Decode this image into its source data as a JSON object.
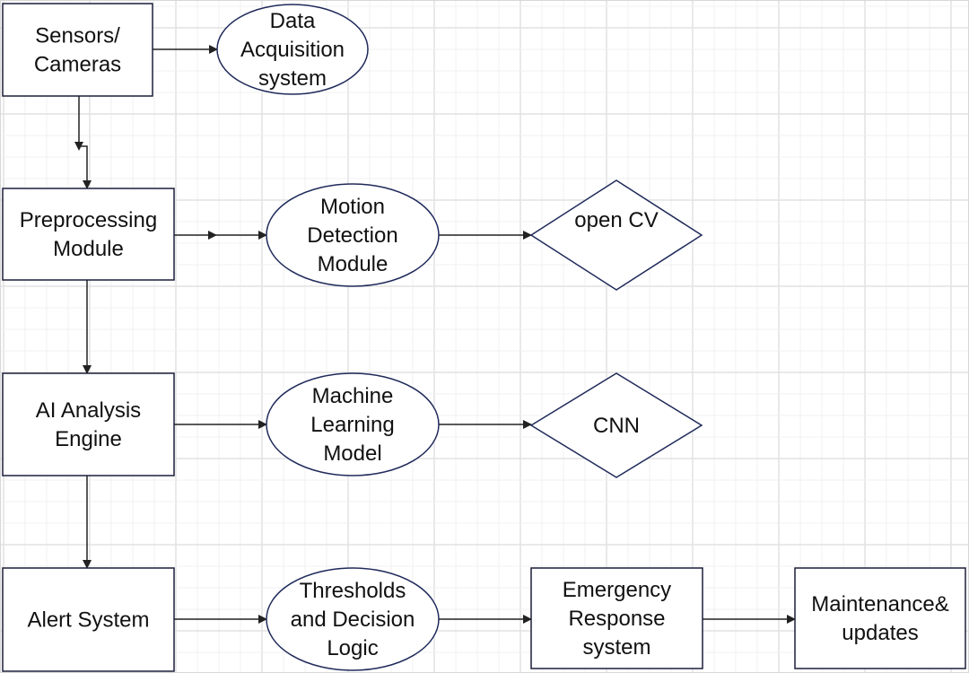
{
  "colors": {
    "shape_stroke": "#1f2a5a",
    "box_stroke": "#1a1f3a",
    "arrow": "#222222",
    "grid_minor": "#f0f0f0",
    "grid_major": "#e2e2e2"
  },
  "nodes": {
    "sensors": {
      "shape": "rectangle",
      "lines": [
        "Sensors/",
        "Cameras"
      ]
    },
    "data_acquisition": {
      "shape": "ellipse",
      "lines": [
        "Data",
        "Acquisition",
        "system"
      ]
    },
    "preprocessing": {
      "shape": "rectangle",
      "lines": [
        "Preprocessing",
        "Module"
      ]
    },
    "motion_detection": {
      "shape": "ellipse",
      "lines": [
        "Motion",
        "Detection",
        "Module"
      ]
    },
    "opencv": {
      "shape": "diamond",
      "lines": [
        "open CV"
      ]
    },
    "ai_engine": {
      "shape": "rectangle",
      "lines": [
        "AI Analysis",
        "Engine"
      ]
    },
    "ml_model": {
      "shape": "ellipse",
      "lines": [
        "Machine",
        "Learning",
        "Model"
      ]
    },
    "cnn": {
      "shape": "diamond",
      "lines": [
        "CNN"
      ]
    },
    "alert": {
      "shape": "rectangle",
      "lines": [
        "Alert System"
      ]
    },
    "thresholds": {
      "shape": "ellipse",
      "lines": [
        "Thresholds",
        "and Decision",
        "Logic"
      ]
    },
    "emergency": {
      "shape": "rectangle",
      "lines": [
        "Emergency",
        "Response",
        "system"
      ]
    },
    "maintenance": {
      "shape": "rectangle",
      "lines": [
        "Maintenance&",
        "updates"
      ]
    }
  },
  "edges": [
    {
      "from": "sensors",
      "to": "data_acquisition"
    },
    {
      "from": "sensors",
      "to": "preprocessing"
    },
    {
      "from": "preprocessing",
      "to": "motion_detection"
    },
    {
      "from": "motion_detection",
      "to": "opencv"
    },
    {
      "from": "preprocessing",
      "to": "ai_engine"
    },
    {
      "from": "ai_engine",
      "to": "ml_model"
    },
    {
      "from": "ml_model",
      "to": "cnn"
    },
    {
      "from": "ai_engine",
      "to": "alert"
    },
    {
      "from": "alert",
      "to": "thresholds"
    },
    {
      "from": "thresholds",
      "to": "emergency"
    },
    {
      "from": "emergency",
      "to": "maintenance"
    }
  ]
}
